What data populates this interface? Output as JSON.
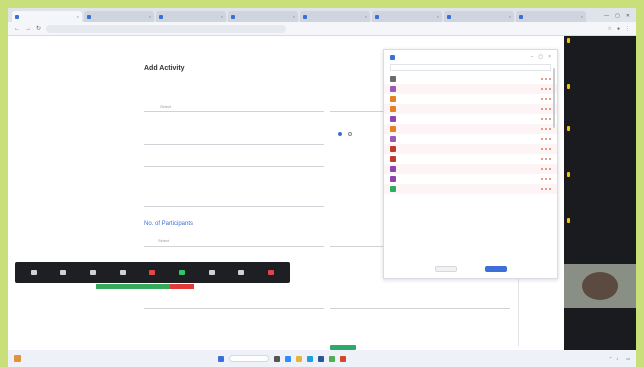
{
  "browser": {
    "tabs": [
      "",
      "",
      "",
      "",
      "",
      "",
      "",
      ""
    ],
    "url": "",
    "window_controls": [
      "—",
      "▢",
      "✕"
    ]
  },
  "form": {
    "title": "Add Activity",
    "subtitle": "",
    "section_participants": "No. of Participants",
    "select_placeholder": "Select",
    "required_error": ""
  },
  "dropdown": {
    "title": "",
    "items": [
      {
        "color": "#6b6b6b"
      },
      {
        "color": "#9b59b6"
      },
      {
        "color": "#e67e22"
      },
      {
        "color": "#e67e22"
      },
      {
        "color": "#8e44ad"
      },
      {
        "color": "#e67e22"
      },
      {
        "color": "#9b59b6"
      },
      {
        "color": "#c0392b"
      },
      {
        "color": "#c0392b"
      },
      {
        "color": "#8e44ad"
      },
      {
        "color": "#8e44ad"
      },
      {
        "color": "#27ae60"
      }
    ]
  },
  "meeting": {
    "participants": [
      "",
      "",
      "",
      "",
      "",
      ""
    ]
  },
  "colors": {
    "page_bg": "#c9e07a",
    "accent_blue": "#3d6fd8",
    "zoom_bar": "#1e1f22",
    "participant_panel": "#1a1b1e"
  }
}
